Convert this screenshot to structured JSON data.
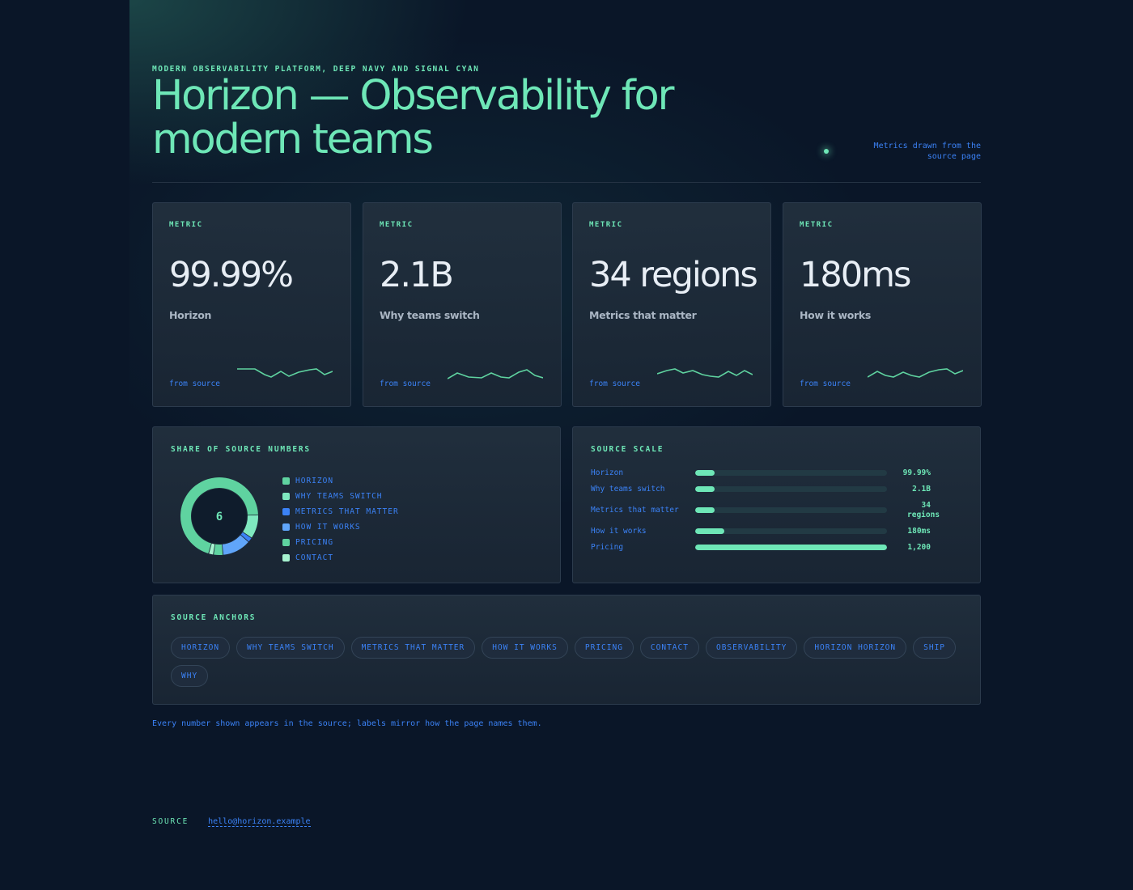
{
  "header": {
    "eyebrow": "MODERN OBSERVABILITY PLATFORM, DEEP NAVY AND SIGNAL CYAN",
    "title": "Horizon — Observability for modern teams",
    "status_text": "Metrics drawn from the source page"
  },
  "metrics": [
    {
      "label": "METRIC",
      "value": "99.99%",
      "sub": "Horizon",
      "from": "from source"
    },
    {
      "label": "METRIC",
      "value": "2.1B",
      "sub": "Why teams switch",
      "from": "from source"
    },
    {
      "label": "METRIC",
      "value": "34 regions",
      "sub": "Metrics that matter",
      "from": "from source"
    },
    {
      "label": "METRIC",
      "value": "180ms",
      "sub": "How it works",
      "from": "from source"
    }
  ],
  "share_panel": {
    "title": "SHARE OF SOURCE NUMBERS",
    "center_value": "6",
    "legend": [
      {
        "label": "HORIZON",
        "color": "#5fd3a0"
      },
      {
        "label": "WHY TEAMS SWITCH",
        "color": "#7fe8bf"
      },
      {
        "label": "METRICS THAT MATTER",
        "color": "#3b82f6"
      },
      {
        "label": "HOW IT WORKS",
        "color": "#60a5fa"
      },
      {
        "label": "PRICING",
        "color": "#5fd3a0"
      },
      {
        "label": "CONTACT",
        "color": "#a7f3d0"
      }
    ]
  },
  "chart_data": {
    "type": "pie",
    "title": "SHARE OF SOURCE NUMBERS",
    "categories": [
      "Horizon",
      "Why teams switch",
      "Metrics that matter",
      "How it works",
      "Pricing",
      "Contact"
    ],
    "values": [
      70,
      10,
      2,
      12,
      4,
      2
    ]
  },
  "scale_panel": {
    "title": "SOURCE SCALE",
    "rows": [
      {
        "label": "Horizon",
        "value": "99.99%",
        "fraction": 0.1
      },
      {
        "label": "Why teams switch",
        "value": "2.1B",
        "fraction": 0.1
      },
      {
        "label": "Metrics that matter",
        "value": "34 regions",
        "fraction": 0.1
      },
      {
        "label": "How it works",
        "value": "180ms",
        "fraction": 0.15
      },
      {
        "label": "Pricing",
        "value": "1,200",
        "fraction": 1.0
      }
    ]
  },
  "anchors": {
    "title": "SOURCE ANCHORS",
    "items": [
      "HORIZON",
      "WHY TEAMS SWITCH",
      "METRICS THAT MATTER",
      "HOW IT WORKS",
      "PRICING",
      "CONTACT",
      "OBSERVABILITY",
      "HORIZON HORIZON",
      "SHIP",
      "WHY"
    ]
  },
  "footnote": "Every number shown appears in the source; labels mirror how the page names them.",
  "footer": {
    "label": "SOURCE",
    "email": "hello@horizon.example"
  },
  "colors": {
    "background": "#0a1628",
    "accent": "#6ee7b7",
    "link": "#3b82f6"
  }
}
